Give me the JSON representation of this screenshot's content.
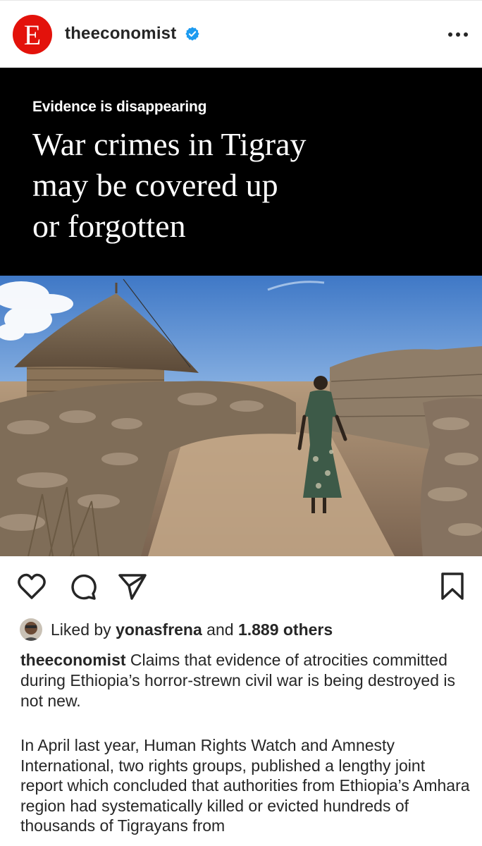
{
  "header": {
    "logo_letter": "E",
    "username": "theeconomist",
    "verified_icon": "verified-badge-icon",
    "more_icon": "more-horizontal-icon"
  },
  "media": {
    "kicker": "Evidence is disappearing",
    "headline": "War crimes in Tigray\nmay be covered up\nor forgotten",
    "photo_icon": "landscape-photo"
  },
  "actions": {
    "like_icon": "heart-icon",
    "comment_icon": "comment-icon",
    "share_icon": "send-icon",
    "save_icon": "bookmark-icon"
  },
  "likes": {
    "prefix": "Liked by",
    "liker": "yonasfrena",
    "joiner": "and",
    "others": "1.889 others"
  },
  "caption": {
    "username": "theeconomist",
    "text": "Claims that evidence of atrocities committed during Ethiopia’s horror-strewn civil war is being destroyed is not new.",
    "paragraph2": "In April last year, Human Rights Watch and Amnesty International, two rights groups, published a lengthy joint report which concluded that authorities from Ethiopia’s Amhara region had systematically killed or evicted hundreds of thousands of Tigrayans from"
  },
  "colors": {
    "brand_red": "#e3120b",
    "verified_blue": "#1d9bf0",
    "text": "#262626"
  }
}
